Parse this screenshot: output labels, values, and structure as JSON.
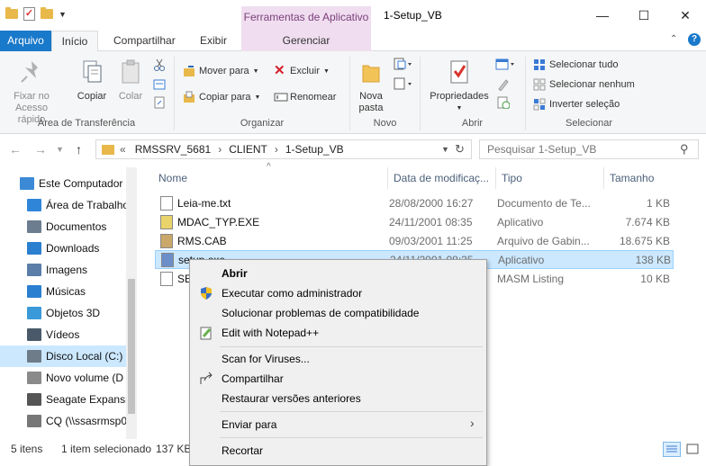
{
  "window": {
    "title": "1-Setup_VB",
    "context_tab_header": "Ferramentas de Aplicativo",
    "controls": {
      "minimize": "—",
      "maximize": "☐",
      "close": "✕"
    }
  },
  "tabs": {
    "arquivo": "Arquivo",
    "inicio": "Início",
    "compartilhar": "Compartilhar",
    "exibir": "Exibir",
    "gerenciar": "Gerenciar"
  },
  "ribbon": {
    "clipboard": {
      "pin": "Fixar no\nAcesso rápido",
      "copy": "Copiar",
      "paste": "Colar",
      "group": "Área de Transferência"
    },
    "organize": {
      "move_to": "Mover para",
      "copy_to": "Copiar para",
      "delete": "Excluir",
      "rename": "Renomear",
      "group": "Organizar"
    },
    "new": {
      "new_folder": "Nova\npasta",
      "group": "Novo"
    },
    "open": {
      "properties": "Propriedades",
      "group": "Abrir"
    },
    "select": {
      "select_all": "Selecionar tudo",
      "select_none": "Selecionar nenhum",
      "invert": "Inverter seleção",
      "group": "Selecionar"
    }
  },
  "address": {
    "overflow": "«",
    "crumbs": [
      "RMSSRV_5681",
      "CLIENT",
      "1-Setup_VB"
    ],
    "search_placeholder": "Pesquisar 1-Setup_VB"
  },
  "nav": [
    {
      "label": "Este Computador",
      "icon": "computer-icon",
      "color": "#3c8ad6"
    },
    {
      "label": "Área de Trabalho",
      "icon": "desktop-icon",
      "color": "#2f86d8"
    },
    {
      "label": "Documentos",
      "icon": "documents-icon",
      "color": "#6b7d8f"
    },
    {
      "label": "Downloads",
      "icon": "downloads-icon",
      "color": "#2b7fd0"
    },
    {
      "label": "Imagens",
      "icon": "pictures-icon",
      "color": "#5a7ea8"
    },
    {
      "label": "Músicas",
      "icon": "music-icon",
      "color": "#2b7fd0"
    },
    {
      "label": "Objetos 3D",
      "icon": "objects3d-icon",
      "color": "#3a9ad9"
    },
    {
      "label": "Vídeos",
      "icon": "videos-icon",
      "color": "#4a5a6a"
    },
    {
      "label": "Disco Local (C:)",
      "icon": "drive-icon",
      "color": "#6e7b88"
    },
    {
      "label": "Novo volume (D",
      "icon": "drive-icon",
      "color": "#8a8a8a"
    },
    {
      "label": "Seagate Expansio",
      "icon": "external-drive-icon",
      "color": "#555555"
    },
    {
      "label": "CQ (\\\\ssasrmsp0",
      "icon": "network-drive-icon",
      "color": "#777777"
    }
  ],
  "columns": {
    "name": "Nome",
    "modified": "Data de modificaç...",
    "type": "Tipo",
    "size": "Tamanho"
  },
  "files": [
    {
      "name": "Leia-me.txt",
      "modified": "28/08/2000 16:27",
      "type": "Documento de Te...",
      "size": "1 KB",
      "icon": "text-file-icon"
    },
    {
      "name": "MDAC_TYP.EXE",
      "modified": "24/11/2001 08:35",
      "type": "Aplicativo",
      "size": "7.674 KB",
      "icon": "exe-file-icon"
    },
    {
      "name": "RMS.CAB",
      "modified": "09/03/2001 11:25",
      "type": "Arquivo de Gabin...",
      "size": "18.675 KB",
      "icon": "cab-file-icon"
    },
    {
      "name": "setup.exe",
      "modified": "24/11/2001 08:35",
      "type": "Aplicativo",
      "size": "138 KB",
      "icon": "setup-file-icon"
    },
    {
      "name": "SE",
      "modified": "",
      "type": "MASM Listing",
      "size": "10 KB",
      "icon": "listing-file-icon"
    }
  ],
  "status": {
    "count": "5 itens",
    "selected": "1 item selecionado",
    "size": "137 KB"
  },
  "context_menu": {
    "open": "Abrir",
    "run_as_admin": "Executar como administrador",
    "troubleshoot": "Solucionar problemas de compatibilidade",
    "notepad": "Edit with Notepad++",
    "scan": "Scan for Viruses...",
    "share": "Compartilhar",
    "restore": "Restaurar versões anteriores",
    "send_to": "Enviar para",
    "cut": "Recortar"
  }
}
